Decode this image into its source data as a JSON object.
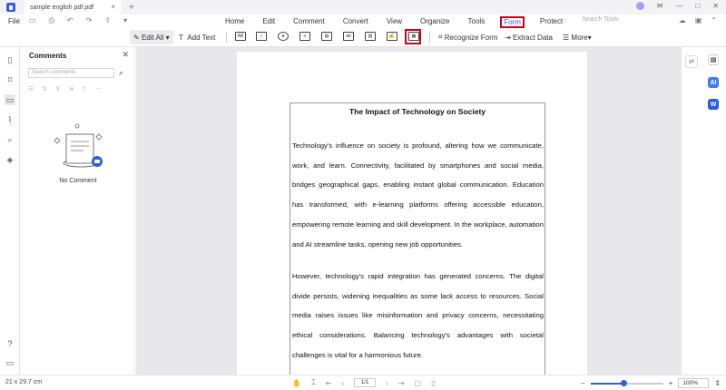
{
  "titlebar": {
    "tab_title": "sample english pdf.pdf",
    "close": "×",
    "new_tab": "+"
  },
  "menu": {
    "file": "File",
    "tabs": [
      "Home",
      "Edit",
      "Comment",
      "Convert",
      "View",
      "Organize",
      "Tools",
      "Form",
      "Protect"
    ],
    "active_tab": "Form",
    "search_placeholder": "Search Tools"
  },
  "toolbar": {
    "edit_all": "Edit All",
    "add_text": "Add Text",
    "recognize_form": "Recognize Form",
    "extract_data": "Extract Data",
    "more": "More"
  },
  "comments": {
    "title": "Comments",
    "search_placeholder": "Search comments",
    "empty_text": "No Comment"
  },
  "document": {
    "title": "The Impact of Technology on Society",
    "paragraph1": "Technology's influence on society is profound, altering how we communicate, work, and learn. Connectivity, facilitated by smartphones and social media, bridges geographical gaps, enabling instant global communication. Education has transformed, with e-learning platforms offering accessible education, empowering remote learning and skill development. In the workplace, automation and AI streamline tasks, opening new job opportunities.",
    "paragraph2": "However, technology's rapid integration has generated concerns. The digital divide persists, widening inequalities as some lack access to resources. Social media raises issues like misinformation and privacy concerns, necessitating ethical considerations. Balancing technology's advantages with societal challenges is vital for a harmonious future."
  },
  "status": {
    "page_size": "21 x 29.7 cm",
    "page_indicator": "1/1",
    "zoom": "100%"
  },
  "colors": {
    "accent": "#2f5fdc",
    "highlight": "#d0021b"
  }
}
